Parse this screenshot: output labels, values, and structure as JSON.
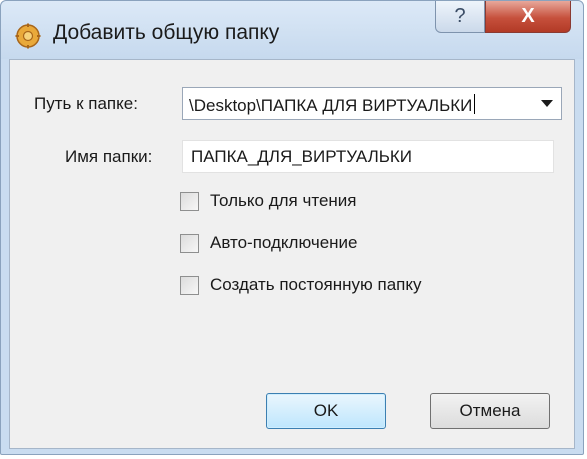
{
  "window": {
    "title": "Добавить общую папку",
    "help_glyph": "?",
    "close_glyph": "X",
    "icon": "gear-folder-icon"
  },
  "form": {
    "path_label": "Путь к папке:",
    "path_value": "\\Desktop\\ПАПКА ДЛЯ ВИРТУАЛЬКИ",
    "name_label": "Имя папки:",
    "name_value": "ПАПКА_ДЛЯ_ВИРТУАЛЬКИ",
    "checkboxes": [
      {
        "label": "Только для чтения",
        "checked": false
      },
      {
        "label": "Авто-подключение",
        "checked": false
      },
      {
        "label": "Создать постоянную папку",
        "checked": false
      }
    ]
  },
  "buttons": {
    "ok_label": "OK",
    "cancel_label": "Отмена"
  },
  "colors": {
    "titlebar": "#c9dcf0",
    "close": "#c6503c",
    "ok_border": "#3c7fb1"
  }
}
